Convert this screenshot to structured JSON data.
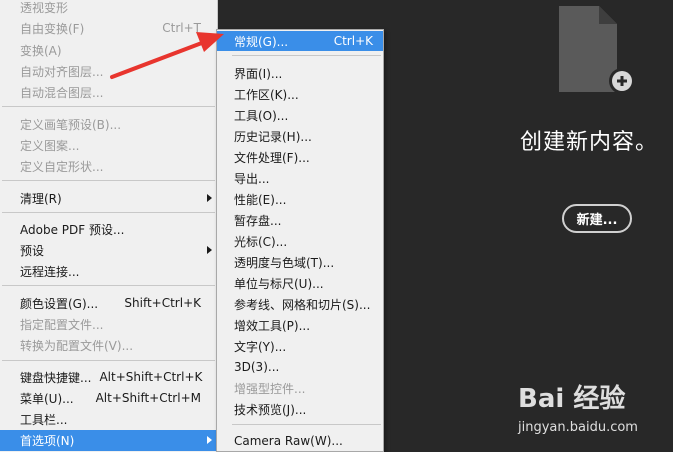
{
  "edit_menu": {
    "items": [
      {
        "label": "透视变形",
        "shortcut": "",
        "disabled": true
      },
      {
        "label": "自由变换(F)",
        "shortcut": "Ctrl+T",
        "disabled": true
      },
      {
        "label": "变换(A)",
        "shortcut": "",
        "disabled": true
      },
      {
        "label": "自动对齐图层...",
        "shortcut": "",
        "disabled": true
      },
      {
        "label": "自动混合图层...",
        "shortcut": "",
        "disabled": true
      },
      {
        "label": "定义画笔预设(B)...",
        "shortcut": "",
        "disabled": true
      },
      {
        "label": "定义图案...",
        "shortcut": "",
        "disabled": true
      },
      {
        "label": "定义自定形状...",
        "shortcut": "",
        "disabled": true
      },
      {
        "label": "清理(R)",
        "shortcut": "",
        "disabled": false,
        "submenu": true
      },
      {
        "label": "Adobe PDF 预设...",
        "shortcut": "",
        "disabled": false
      },
      {
        "label": "预设",
        "shortcut": "",
        "disabled": false,
        "submenu": true
      },
      {
        "label": "远程连接...",
        "shortcut": "",
        "disabled": false
      },
      {
        "label": "颜色设置(G)...",
        "shortcut": "Shift+Ctrl+K",
        "disabled": false
      },
      {
        "label": "指定配置文件...",
        "shortcut": "",
        "disabled": true
      },
      {
        "label": "转换为配置文件(V)...",
        "shortcut": "",
        "disabled": true
      },
      {
        "label": "键盘快捷键...",
        "shortcut": "Alt+Shift+Ctrl+K",
        "disabled": false
      },
      {
        "label": "菜单(U)...",
        "shortcut": "Alt+Shift+Ctrl+M",
        "disabled": false
      },
      {
        "label": "工具栏...",
        "shortcut": "",
        "disabled": false
      },
      {
        "label": "首选项(N)",
        "shortcut": "",
        "disabled": false,
        "submenu": true,
        "highlighted": true
      }
    ]
  },
  "preferences_menu": {
    "items": [
      {
        "label": "常规(G)...",
        "shortcut": "Ctrl+K",
        "highlighted": true
      },
      {
        "label": "界面(I)..."
      },
      {
        "label": "工作区(K)..."
      },
      {
        "label": "工具(O)..."
      },
      {
        "label": "历史记录(H)..."
      },
      {
        "label": "文件处理(F)..."
      },
      {
        "label": "导出..."
      },
      {
        "label": "性能(E)..."
      },
      {
        "label": "暂存盘..."
      },
      {
        "label": "光标(C)..."
      },
      {
        "label": "透明度与色域(T)..."
      },
      {
        "label": "单位与标尺(U)..."
      },
      {
        "label": "参考线、网格和切片(S)..."
      },
      {
        "label": "增效工具(P)..."
      },
      {
        "label": "文字(Y)..."
      },
      {
        "label": "3D(3)..."
      },
      {
        "label": "增强型控件...",
        "disabled": true
      },
      {
        "label": "技术预览(J)..."
      },
      {
        "label": "Camera Raw(W)..."
      }
    ]
  },
  "start_panel": {
    "title": "创建新内容。",
    "new_button": "新建..."
  },
  "watermark": {
    "logo": "Bai 经验",
    "url": "jingyan.baidu.com"
  },
  "colors": {
    "highlight": "#3a8ee8",
    "background_dark": "#282828",
    "menu_bg": "#f0f0f0",
    "arrow_red": "#e8352e"
  }
}
